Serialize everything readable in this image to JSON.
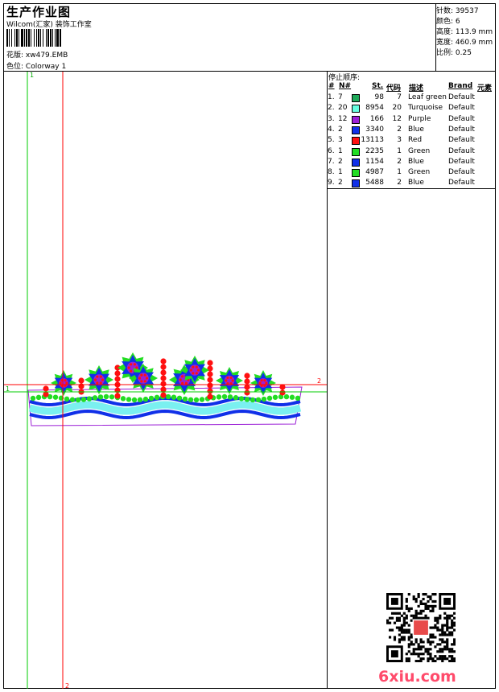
{
  "header": {
    "title": "生产作业图",
    "company": "Wilcom(汇家) 装饰工作室",
    "design_label": "花版:",
    "design_value": "xw479.EMB",
    "colorway_label": "色位:",
    "colorway_value": "Colorway 1"
  },
  "stats": [
    {
      "label": "针数:",
      "value": "39537"
    },
    {
      "label": "颜色:",
      "value": "6"
    },
    {
      "label": "高度:",
      "value": "113.9 mm"
    },
    {
      "label": "宽度:",
      "value": "460.9 mm"
    },
    {
      "label": "比例:",
      "value": "0.25"
    }
  ],
  "stop_sequence": {
    "title": "停止顺序:",
    "headers": [
      "#",
      "N#",
      "St.",
      "代码",
      "描述",
      "Brand",
      "元素"
    ],
    "rows": [
      {
        "idx": "1.",
        "n": "7",
        "color": "#1faa5a",
        "st": "98",
        "code": "7",
        "desc": "Leaf green",
        "brand": "Default"
      },
      {
        "idx": "2.",
        "n": "20",
        "color": "#66ffe0",
        "st": "8954",
        "code": "20",
        "desc": "Turquoise",
        "brand": "Default"
      },
      {
        "idx": "3.",
        "n": "12",
        "color": "#9b1fd6",
        "st": "166",
        "code": "12",
        "desc": "Purple",
        "brand": "Default"
      },
      {
        "idx": "4.",
        "n": "2",
        "color": "#1030e8",
        "st": "3340",
        "code": "2",
        "desc": "Blue",
        "brand": "Default"
      },
      {
        "idx": "5.",
        "n": "3",
        "color": "#ff1010",
        "st": "13113",
        "code": "3",
        "desc": "Red",
        "brand": "Default"
      },
      {
        "idx": "6.",
        "n": "1",
        "color": "#22dd22",
        "st": "2235",
        "code": "1",
        "desc": "Green",
        "brand": "Default"
      },
      {
        "idx": "7.",
        "n": "2",
        "color": "#1030e8",
        "st": "1154",
        "code": "2",
        "desc": "Blue",
        "brand": "Default"
      },
      {
        "idx": "8.",
        "n": "1",
        "color": "#22dd22",
        "st": "4987",
        "code": "1",
        "desc": "Green",
        "brand": "Default"
      },
      {
        "idx": "9.",
        "n": "2",
        "color": "#1030e8",
        "st": "5488",
        "code": "2",
        "desc": "Blue",
        "brand": "Default"
      }
    ]
  },
  "canvas": {
    "guide_green_label": "1",
    "guide_red_bottom_label": "2",
    "guide_red_right_label": "2",
    "guide_green_left_label": "1"
  },
  "colors": {
    "blue": "#1030e8",
    "turquoise": "#7af0f0",
    "red": "#ff1010",
    "green": "#22dd22",
    "purple": "#9b1fd6",
    "guide_red": "#ff0000",
    "guide_green": "#00cc00"
  },
  "watermark": "6xiu.com",
  "qr_icon": "qr-code-icon"
}
